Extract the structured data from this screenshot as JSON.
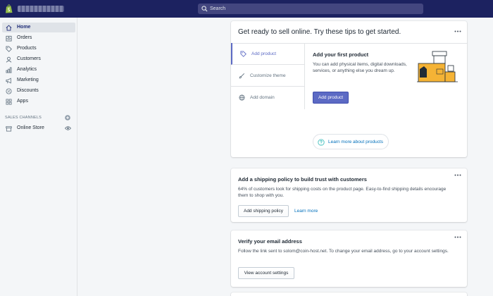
{
  "header": {
    "search_placeholder": "Search"
  },
  "sidebar": {
    "items": [
      {
        "label": "Home",
        "icon": "home-icon",
        "active": true
      },
      {
        "label": "Orders",
        "icon": "orders-icon"
      },
      {
        "label": "Products",
        "icon": "tag-icon"
      },
      {
        "label": "Customers",
        "icon": "person-icon"
      },
      {
        "label": "Analytics",
        "icon": "bar-chart-icon"
      },
      {
        "label": "Marketing",
        "icon": "megaphone-icon"
      },
      {
        "label": "Discounts",
        "icon": "discount-icon"
      },
      {
        "label": "Apps",
        "icon": "apps-icon"
      }
    ],
    "sales_channels_label": "SALES CHANNELS",
    "channels": [
      {
        "label": "Online Store",
        "icon": "store-icon"
      }
    ]
  },
  "tips_card": {
    "title": "Get ready to sell online. Try these tips to get started.",
    "tabs": [
      {
        "label": "Add product",
        "icon": "tag-icon",
        "active": true
      },
      {
        "label": "Customize theme",
        "icon": "brush-icon"
      },
      {
        "label": "Add domain",
        "icon": "globe-icon"
      }
    ],
    "heading": "Add your first product",
    "body": "You can add physical items, digital downloads, services, or anything else you dream up.",
    "primary_button": "Add product",
    "learn_more": "Learn more about products"
  },
  "shipping_card": {
    "heading": "Add a shipping policy to build trust with customers",
    "body": "64% of customers look for shipping costs on the product page. Easy-to-find shipping details encourage them to shop with you.",
    "button": "Add shipping policy",
    "link": "Learn more"
  },
  "email_card": {
    "heading": "Verify your email address",
    "body": "Follow the link sent to solom@coin-host.net. To change your email address, go to your account settings.",
    "button": "View account settings"
  },
  "colors": {
    "topbar": "#1c2260",
    "accent": "#5c6ac4",
    "link": "#006fbb",
    "logo_green": "#95bf47"
  }
}
